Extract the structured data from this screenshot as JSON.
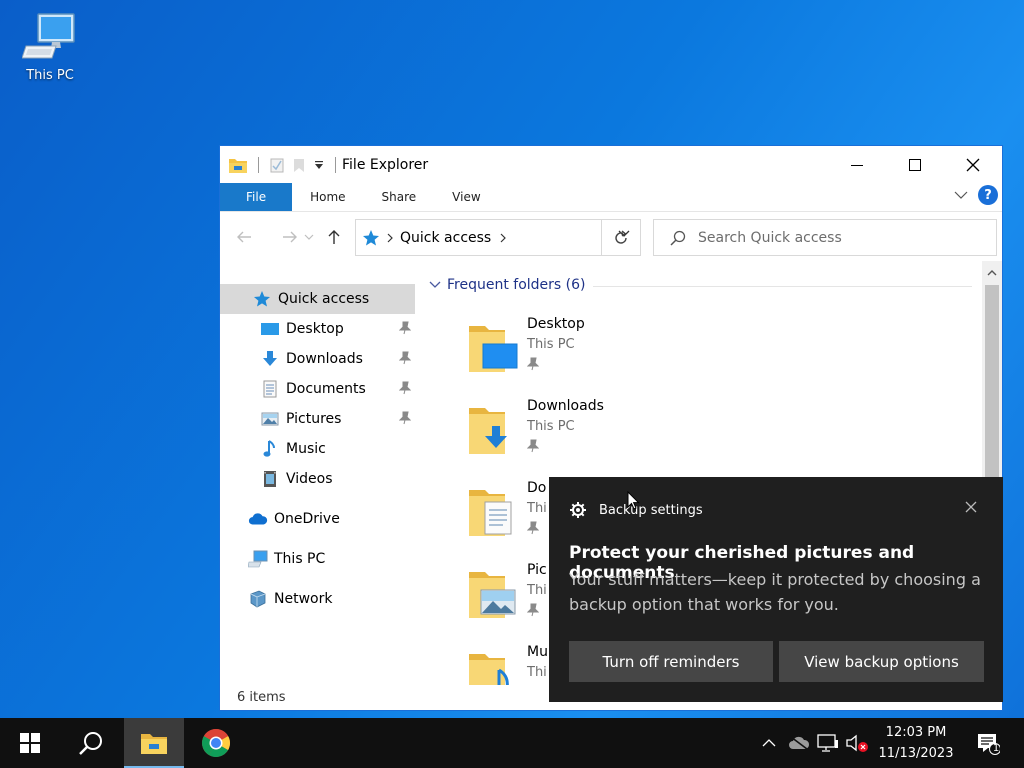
{
  "desktop": {
    "this_pc_label": "This PC"
  },
  "explorer": {
    "title": "File Explorer",
    "ribbon_tabs": [
      "File",
      "Home",
      "Share",
      "View"
    ],
    "address": {
      "crumb": "Quick access"
    },
    "search": {
      "placeholder": "Search Quick access"
    },
    "nav": {
      "quick_access": "Quick access",
      "pinned": [
        "Desktop",
        "Downloads",
        "Documents",
        "Pictures"
      ],
      "unpinned": [
        "Music",
        "Videos"
      ],
      "onedrive": "OneDrive",
      "this_pc": "This PC",
      "network": "Network"
    },
    "frequent_header": "Frequent folders (6)",
    "folders": [
      {
        "name": "Desktop",
        "location": "This PC"
      },
      {
        "name": "Downloads",
        "location": "This PC"
      },
      {
        "name": "Do",
        "location": "Thi"
      },
      {
        "name": "Pic",
        "location": "Thi"
      },
      {
        "name": "Mu",
        "location": "Thi"
      }
    ],
    "status": "6 items"
  },
  "toast": {
    "app": "Backup settings",
    "title": "Protect your cherished pictures and documents",
    "body": "Your stuff matters—keep it protected by choosing a backup option that works for you.",
    "button_turn_off": "Turn off reminders",
    "button_view": "View backup options"
  },
  "taskbar": {
    "time": "12:03 PM",
    "date": "11/13/2023",
    "notification_count": "1"
  },
  "colors": {
    "accent": "#1979ca",
    "desktop": "#0b78de",
    "toast_bg": "#1f1f1f",
    "taskbar_bg": "#101010"
  }
}
